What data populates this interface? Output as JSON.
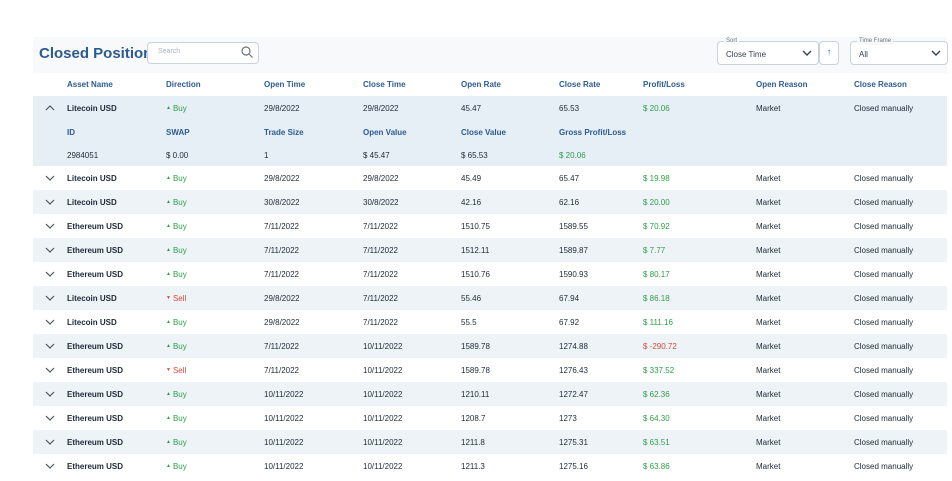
{
  "title": "Closed Positions",
  "search": {
    "placeholder": "Search"
  },
  "sort": {
    "label": "Sort",
    "value": "Close Time",
    "direction_symbol": "↑"
  },
  "time_frame": {
    "label": "Time Frame",
    "value": "All"
  },
  "columns": [
    "Asset Name",
    "Direction",
    "Open Time",
    "Close Time",
    "Open Rate",
    "Close Rate",
    "Profit/Loss",
    "Open Reason",
    "Close Reason"
  ],
  "expanded_detail": {
    "headers": [
      "ID",
      "SWAP",
      "Trade Size",
      "Open Value",
      "Close Value",
      "Gross Profit/Loss"
    ],
    "values": [
      "2984051",
      "$ 0.00",
      "1",
      "$ 45.47",
      "$ 65.53",
      "$ 20.06"
    ]
  },
  "rows": [
    {
      "asset": "Litecoin USD",
      "dir": "Buy",
      "open_time": "29/8/2022",
      "close_time": "29/8/2022",
      "open_rate": "45.47",
      "close_rate": "65.53",
      "pl": "$ 20.06",
      "open_reason": "Market",
      "close_reason": "Closed manually"
    },
    {
      "asset": "Litecoin USD",
      "dir": "Buy",
      "open_time": "29/8/2022",
      "close_time": "29/8/2022",
      "open_rate": "45.49",
      "close_rate": "65.47",
      "pl": "$ 19.98",
      "open_reason": "Market",
      "close_reason": "Closed manually"
    },
    {
      "asset": "Litecoin USD",
      "dir": "Buy",
      "open_time": "30/8/2022",
      "close_time": "30/8/2022",
      "open_rate": "42.16",
      "close_rate": "62.16",
      "pl": "$ 20.00",
      "open_reason": "Market",
      "close_reason": "Closed manually"
    },
    {
      "asset": "Ethereum USD",
      "dir": "Buy",
      "open_time": "7/11/2022",
      "close_time": "7/11/2022",
      "open_rate": "1510.75",
      "close_rate": "1589.55",
      "pl": "$ 70.92",
      "open_reason": "Market",
      "close_reason": "Closed manually"
    },
    {
      "asset": "Ethereum USD",
      "dir": "Buy",
      "open_time": "7/11/2022",
      "close_time": "7/11/2022",
      "open_rate": "1512.11",
      "close_rate": "1589.87",
      "pl": "$ 7.77",
      "open_reason": "Market",
      "close_reason": "Closed manually"
    },
    {
      "asset": "Ethereum USD",
      "dir": "Buy",
      "open_time": "7/11/2022",
      "close_time": "7/11/2022",
      "open_rate": "1510.76",
      "close_rate": "1590.93",
      "pl": "$ 80.17",
      "open_reason": "Market",
      "close_reason": "Closed manually"
    },
    {
      "asset": "Litecoin USD",
      "dir": "Sell",
      "open_time": "29/8/2022",
      "close_time": "7/11/2022",
      "open_rate": "55.46",
      "close_rate": "67.94",
      "pl": "$ 86.18",
      "open_reason": "Market",
      "close_reason": "Closed manually"
    },
    {
      "asset": "Litecoin USD",
      "dir": "Buy",
      "open_time": "29/8/2022",
      "close_time": "7/11/2022",
      "open_rate": "55.5",
      "close_rate": "67.92",
      "pl": "$ 111.16",
      "open_reason": "Market",
      "close_reason": "Closed manually"
    },
    {
      "asset": "Ethereum USD",
      "dir": "Buy",
      "open_time": "7/11/2022",
      "close_time": "10/11/2022",
      "open_rate": "1589.78",
      "close_rate": "1274.88",
      "pl": "$ -290.72",
      "open_reason": "Market",
      "close_reason": "Closed manually"
    },
    {
      "asset": "Ethereum USD",
      "dir": "Sell",
      "open_time": "7/11/2022",
      "close_time": "10/11/2022",
      "open_rate": "1589.78",
      "close_rate": "1276.43",
      "pl": "$ 337.52",
      "open_reason": "Market",
      "close_reason": "Closed manually"
    },
    {
      "asset": "Ethereum USD",
      "dir": "Buy",
      "open_time": "10/11/2022",
      "close_time": "10/11/2022",
      "open_rate": "1210.11",
      "close_rate": "1272.47",
      "pl": "$ 62.36",
      "open_reason": "Market",
      "close_reason": "Closed manually"
    },
    {
      "asset": "Ethereum USD",
      "dir": "Buy",
      "open_time": "10/11/2022",
      "close_time": "10/11/2022",
      "open_rate": "1208.7",
      "close_rate": "1273",
      "pl": "$ 64.30",
      "open_reason": "Market",
      "close_reason": "Closed manually"
    },
    {
      "asset": "Ethereum USD",
      "dir": "Buy",
      "open_time": "10/11/2022",
      "close_time": "10/11/2022",
      "open_rate": "1211.8",
      "close_rate": "1275.31",
      "pl": "$ 63.51",
      "open_reason": "Market",
      "close_reason": "Closed manually"
    },
    {
      "asset": "Ethereum USD",
      "dir": "Buy",
      "open_time": "10/11/2022",
      "close_time": "10/11/2022",
      "open_rate": "1211.3",
      "close_rate": "1275.16",
      "pl": "$ 63.86",
      "open_reason": "Market",
      "close_reason": "Closed manually"
    }
  ],
  "colors": {
    "accent": "#2c5c8f",
    "positive": "#2e9e48",
    "negative": "#d84a3a"
  }
}
